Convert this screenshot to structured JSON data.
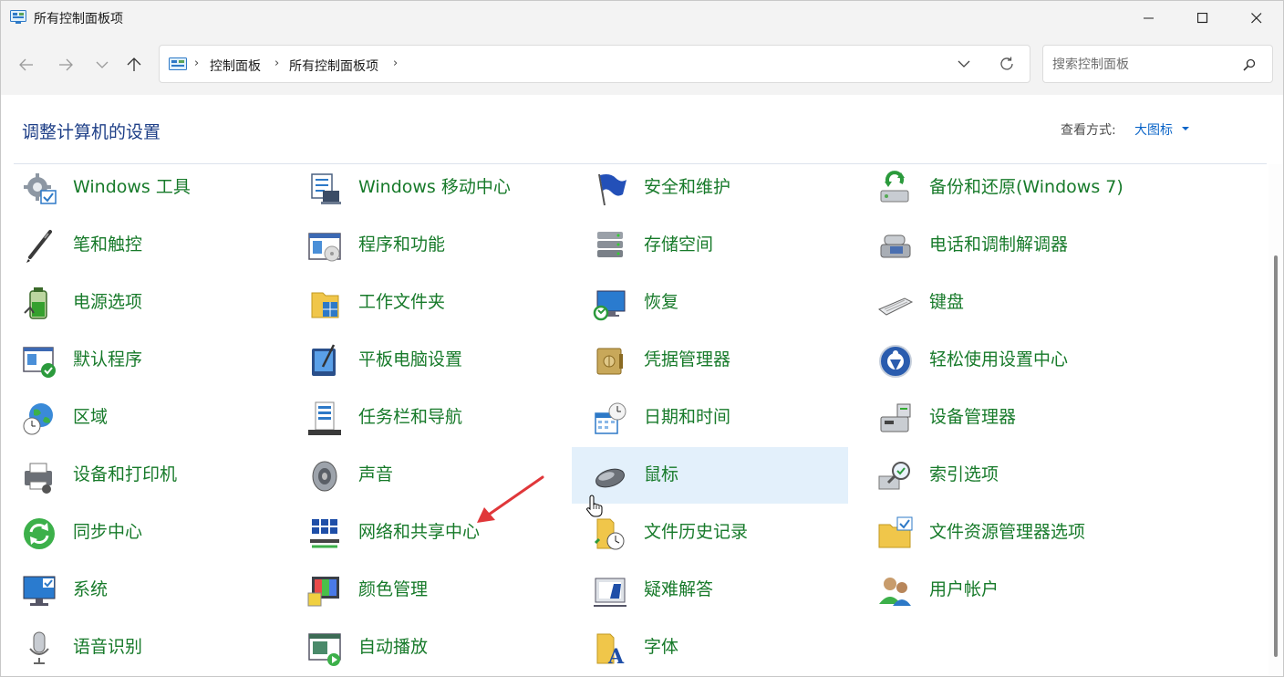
{
  "window": {
    "title": "所有控制面板项"
  },
  "nav": {
    "breadcrumb": [
      "控制面板",
      "所有控制面板项"
    ],
    "search_placeholder": "搜索控制面板"
  },
  "header": {
    "title": "调整计算机的设置",
    "view_by_label": "查看方式:",
    "view_by_value": "大图标"
  },
  "colors": {
    "item_text": "#177a2a",
    "title_text": "#1e3f87",
    "link": "#0a64c8",
    "hover_bg": "#e3f0fb"
  },
  "items": [
    {
      "label": "Windows 工具",
      "icon": "windows-tools-icon"
    },
    {
      "label": "Windows 移动中心",
      "icon": "mobility-center-icon"
    },
    {
      "label": "安全和维护",
      "icon": "security-flag-icon"
    },
    {
      "label": "备份和还原(Windows 7)",
      "icon": "backup-restore-icon"
    },
    {
      "label": "笔和触控",
      "icon": "pen-icon"
    },
    {
      "label": "程序和功能",
      "icon": "programs-icon"
    },
    {
      "label": "存储空间",
      "icon": "storage-icon"
    },
    {
      "label": "电话和调制解调器",
      "icon": "phone-modem-icon"
    },
    {
      "label": "电源选项",
      "icon": "battery-icon"
    },
    {
      "label": "工作文件夹",
      "icon": "work-folders-icon"
    },
    {
      "label": "恢复",
      "icon": "recovery-icon"
    },
    {
      "label": "键盘",
      "icon": "keyboard-icon"
    },
    {
      "label": "默认程序",
      "icon": "default-programs-icon"
    },
    {
      "label": "平板电脑设置",
      "icon": "tablet-icon"
    },
    {
      "label": "凭据管理器",
      "icon": "credential-vault-icon"
    },
    {
      "label": "轻松使用设置中心",
      "icon": "ease-of-access-icon"
    },
    {
      "label": "区域",
      "icon": "globe-clock-icon"
    },
    {
      "label": "任务栏和导航",
      "icon": "taskbar-icon"
    },
    {
      "label": "日期和时间",
      "icon": "calendar-clock-icon"
    },
    {
      "label": "设备管理器",
      "icon": "device-manager-icon"
    },
    {
      "label": "设备和打印机",
      "icon": "printer-icon"
    },
    {
      "label": "声音",
      "icon": "speaker-icon"
    },
    {
      "label": "鼠标",
      "icon": "mouse-icon",
      "hovered": true
    },
    {
      "label": "索引选项",
      "icon": "indexing-icon"
    },
    {
      "label": "同步中心",
      "icon": "sync-icon"
    },
    {
      "label": "网络和共享中心",
      "icon": "network-icon"
    },
    {
      "label": "文件历史记录",
      "icon": "file-history-icon"
    },
    {
      "label": "文件资源管理器选项",
      "icon": "folder-options-icon"
    },
    {
      "label": "系统",
      "icon": "system-monitor-icon"
    },
    {
      "label": "颜色管理",
      "icon": "color-management-icon"
    },
    {
      "label": "疑难解答",
      "icon": "troubleshoot-icon"
    },
    {
      "label": "用户帐户",
      "icon": "user-accounts-icon"
    },
    {
      "label": "语音识别",
      "icon": "microphone-icon"
    },
    {
      "label": "自动播放",
      "icon": "autoplay-icon"
    },
    {
      "label": "字体",
      "icon": "fonts-icon"
    }
  ]
}
